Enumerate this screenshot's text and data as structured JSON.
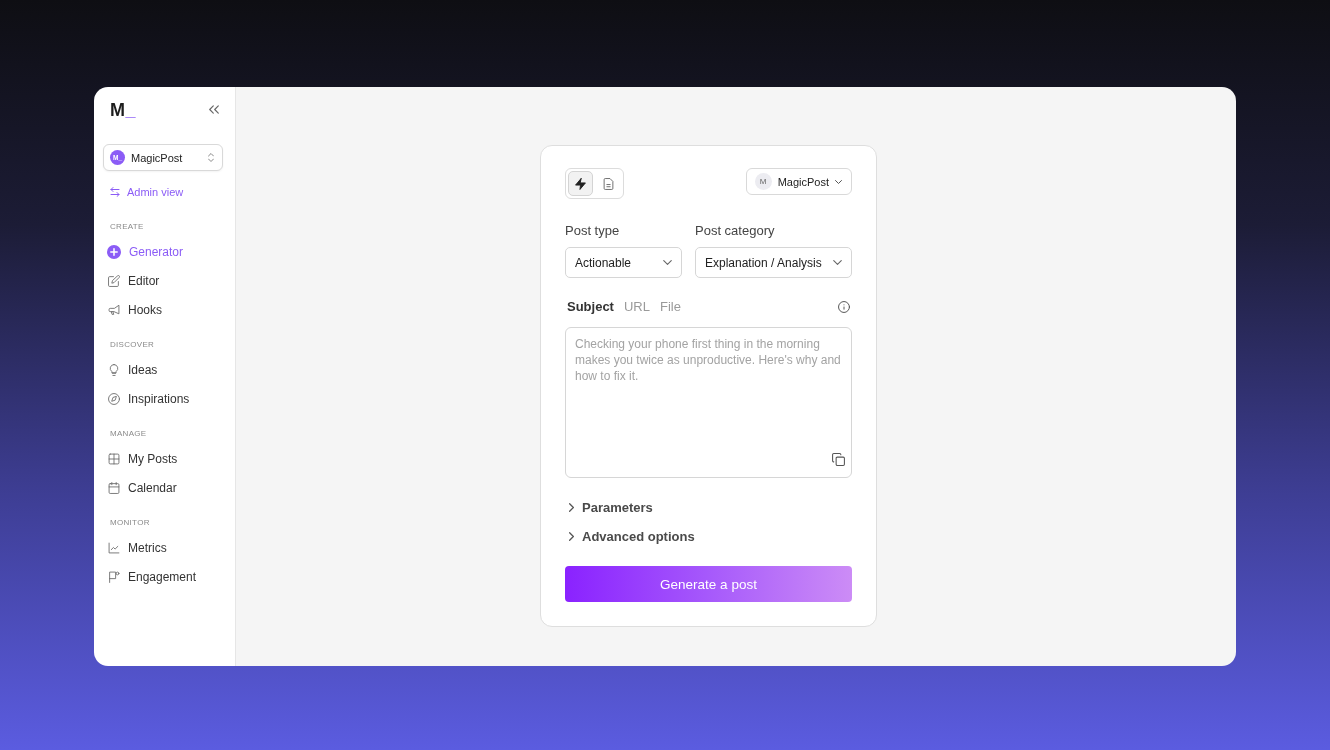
{
  "sidebar": {
    "logo": {
      "letter": "M",
      "accent": "_"
    },
    "workspace": {
      "avatar": "M_",
      "name": "MagicPost"
    },
    "admin_link": "Admin view",
    "sections": [
      {
        "title": "CREATE",
        "items": [
          {
            "label": "Generator",
            "selected": true
          },
          {
            "label": "Editor",
            "selected": false
          },
          {
            "label": "Hooks",
            "selected": false
          }
        ]
      },
      {
        "title": "DISCOVER",
        "items": [
          {
            "label": "Ideas",
            "selected": false
          },
          {
            "label": "Inspirations",
            "selected": false
          }
        ]
      },
      {
        "title": "MANAGE",
        "items": [
          {
            "label": "My Posts",
            "selected": false
          },
          {
            "label": "Calendar",
            "selected": false
          }
        ]
      },
      {
        "title": "MONITOR",
        "items": [
          {
            "label": "Metrics",
            "selected": false
          },
          {
            "label": "Engagement",
            "selected": false
          }
        ]
      }
    ]
  },
  "generator": {
    "mode_buttons": [
      {
        "selected": true
      },
      {
        "selected": false
      }
    ],
    "account": {
      "avatar": "M",
      "name": "MagicPost"
    },
    "fields": [
      {
        "label": "Post type",
        "value": "Actionable"
      },
      {
        "label": "Post category",
        "value": "Explanation / Analysis"
      }
    ],
    "source_tabs": [
      {
        "label": "Subject",
        "selected": true
      },
      {
        "label": "URL",
        "selected": false
      },
      {
        "label": "File",
        "selected": false
      }
    ],
    "subject": {
      "placeholder": "Checking your phone first thing in the morning makes you twice as unproductive. Here's why and how to fix it."
    },
    "options": [
      {
        "label": "Parameters",
        "expanded": false
      },
      {
        "label": "Advanced options",
        "expanded": false
      }
    ],
    "submit": "Generate a post"
  }
}
